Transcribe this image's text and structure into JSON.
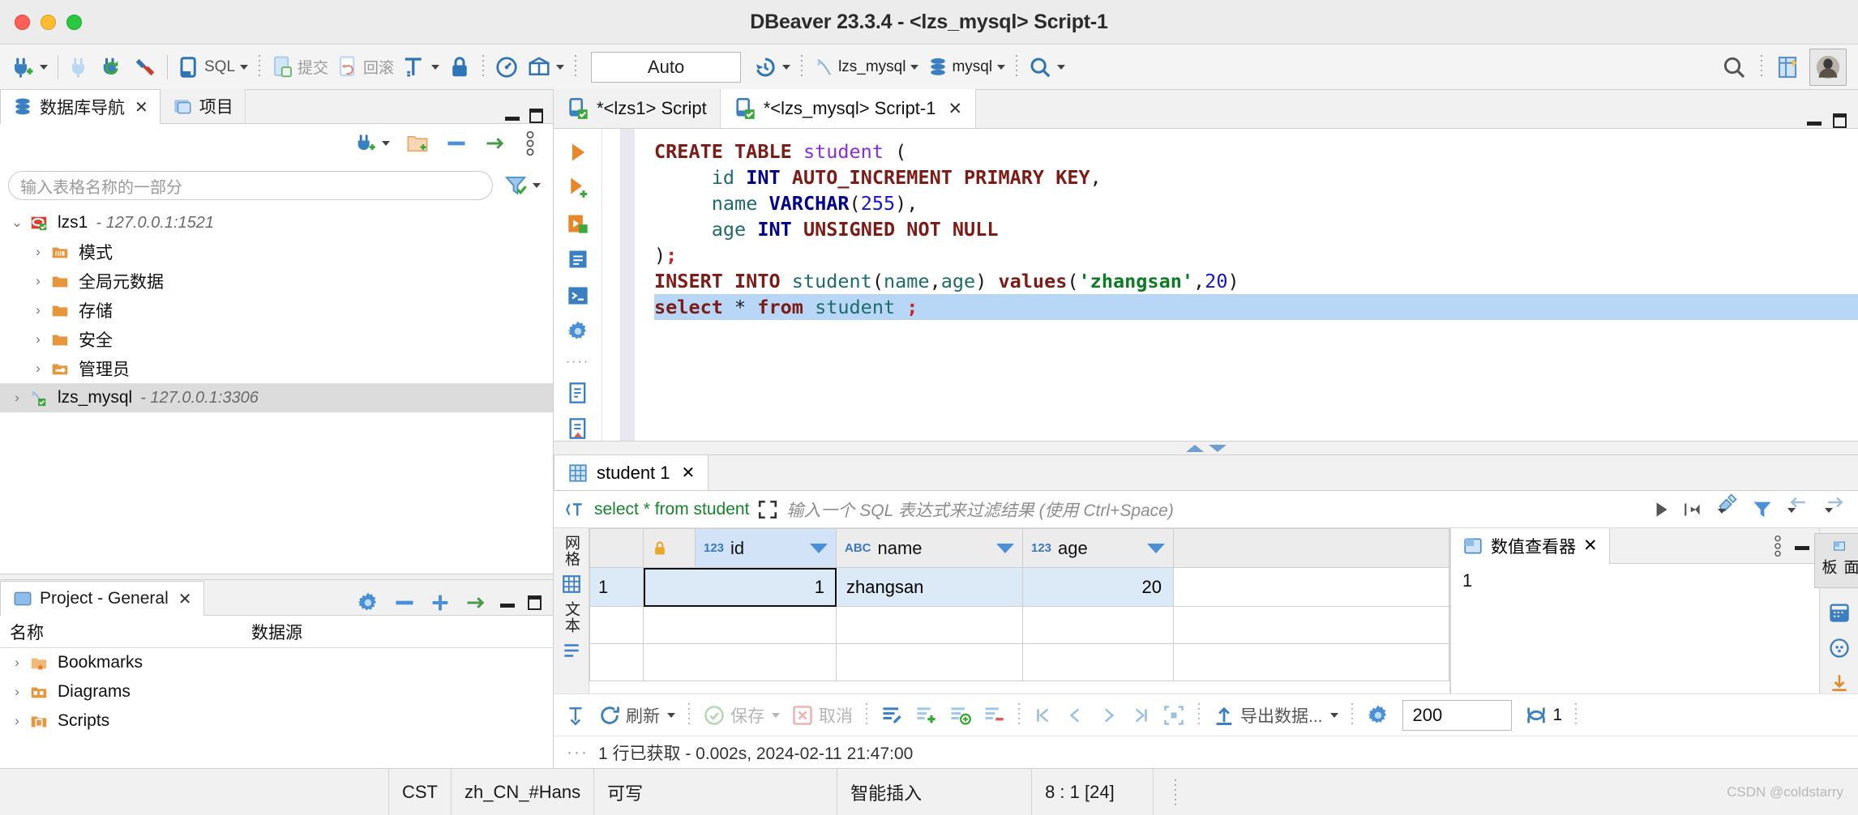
{
  "window": {
    "title": "DBeaver 23.3.4 - <lzs_mysql> Script-1"
  },
  "toolbar": {
    "sql_label": "SQL",
    "commit_label": "提交",
    "rollback_label": "回滚",
    "auto_label": "Auto",
    "connection_label": "lzs_mysql",
    "database_label": "mysql"
  },
  "navigator": {
    "tabs": [
      {
        "label": "数据库导航",
        "icon": "database-icon",
        "active": true
      },
      {
        "label": "项目",
        "icon": "project-icon",
        "active": false
      }
    ],
    "filter_placeholder": "输入表格名称的一部分",
    "tree": [
      {
        "label": "lzs1",
        "suffix": "- 127.0.0.1:1521",
        "icon": "oracle-connection-icon",
        "level": 0,
        "expanded": true,
        "selected": false
      },
      {
        "label": "模式",
        "suffix": "",
        "icon": "schema-folder-icon",
        "level": 1,
        "expanded": false,
        "selected": false
      },
      {
        "label": "全局元数据",
        "suffix": "",
        "icon": "folder-icon",
        "level": 1,
        "expanded": false,
        "selected": false
      },
      {
        "label": "存储",
        "suffix": "",
        "icon": "folder-icon",
        "level": 1,
        "expanded": false,
        "selected": false
      },
      {
        "label": "安全",
        "suffix": "",
        "icon": "folder-icon",
        "level": 1,
        "expanded": false,
        "selected": false
      },
      {
        "label": "管理员",
        "suffix": "",
        "icon": "admin-folder-icon",
        "level": 1,
        "expanded": false,
        "selected": false
      },
      {
        "label": "lzs_mysql",
        "suffix": "- 127.0.0.1:3306",
        "icon": "mysql-connection-icon",
        "level": 0,
        "expanded": false,
        "selected": true
      }
    ]
  },
  "project": {
    "tab_label": "Project - General",
    "columns": [
      "名称",
      "数据源"
    ],
    "rows": [
      {
        "label": "Bookmarks",
        "icon": "bookmarks-folder-icon"
      },
      {
        "label": "Diagrams",
        "icon": "diagrams-folder-icon"
      },
      {
        "label": "Scripts",
        "icon": "scripts-folder-icon"
      }
    ]
  },
  "editor": {
    "tabs": [
      {
        "label": "*<lzs1> Script",
        "active": false,
        "closable": false
      },
      {
        "label": "*<lzs_mysql> Script-1",
        "active": true,
        "closable": true
      }
    ],
    "sql_lines": [
      "CREATE TABLE student (",
      "    id INT AUTO_INCREMENT PRIMARY KEY,",
      "    name VARCHAR(255),",
      "    age INT UNSIGNED NOT NULL",
      ");",
      "INSERT INTO student(name,age) values('zhangsan',20)",
      "select * from student ;"
    ]
  },
  "results": {
    "tab_label": "student 1",
    "query_text": "select * from student",
    "filter_placeholder": "输入一个 SQL 表达式来过滤结果 (使用 Ctrl+Space)",
    "vertical_tabs": [
      "网格",
      "文本"
    ],
    "columns": [
      {
        "label": "",
        "type": "",
        "icon": "lock-icon"
      },
      {
        "label": "id",
        "type": "123",
        "icon": "number-type-icon"
      },
      {
        "label": "name",
        "type": "ABC",
        "icon": "text-type-icon"
      },
      {
        "label": "age",
        "type": "123",
        "icon": "number-type-icon"
      }
    ],
    "rows": [
      {
        "no": "1",
        "id": "1",
        "name": "zhangsan",
        "age": "20"
      }
    ],
    "value_viewer": {
      "tab_label": "数值查看器",
      "value": "1"
    },
    "grid_toolbar": {
      "refresh_label": "刷新",
      "save_label": "保存",
      "cancel_label": "取消",
      "export_label": "导出数据...",
      "fetch_size": "200",
      "row_count": "1"
    },
    "status": "1 行已获取 - 0.002s, 2024-02-11 21:47:00"
  },
  "right_rail": {
    "tabs": [
      "面板"
    ]
  },
  "statusbar": {
    "timezone": "CST",
    "locale": "zh_CN_#Hans",
    "writable": "可写",
    "insert_mode": "智能插入",
    "cursor": "8 : 1 [24]",
    "watermark": "CSDN @coldstarry"
  }
}
